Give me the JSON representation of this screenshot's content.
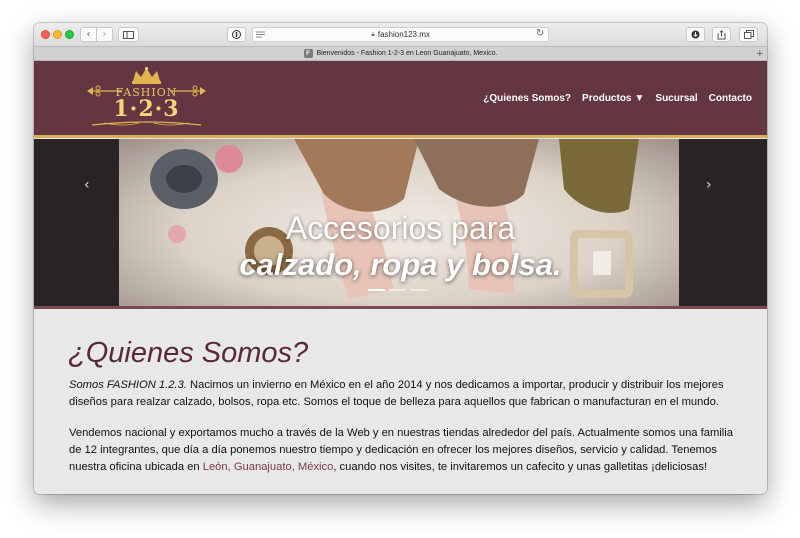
{
  "browser": {
    "url": "fashion123.mx",
    "tab_title": "Bienvenidos - Fashion 1-2-3 en Leon Guanajuato, Mexico.",
    "favicon_letter": "F",
    "icons": {
      "back": "chevron-left-icon",
      "forward": "chevron-right-icon",
      "sidebar": "sidebar-icon",
      "shield": "shield-icon",
      "reader": "reader-icon",
      "lock": "lock-icon",
      "reload": "reload-icon",
      "download": "download-icon",
      "share": "share-icon",
      "tabs": "tabs-icon",
      "new_tab": "plus-icon"
    }
  },
  "site": {
    "logo_line1": "FASHION",
    "logo_line2": "1·2·3",
    "nav": [
      {
        "label": "¿Quienes Somos?"
      },
      {
        "label": "Productos"
      },
      {
        "label": "Sucursal"
      },
      {
        "label": "Contacto"
      }
    ],
    "colors": {
      "header": "#633641",
      "gold": "#d8ae57"
    }
  },
  "hero": {
    "title_line1": "Accesorios para",
    "title_line2": "calzado, ropa y bolsa.",
    "slides": 3,
    "active_slide": 1
  },
  "about": {
    "heading": "¿Quienes Somos?",
    "p1_em": "Somos FASHION 1.2.3.",
    "p1_rest": " Nacimos un invierno en México en el año 2014 y nos dedicamos a importar, producir y distribuir los mejores diseños para realzar calzado, bolsos, ropa etc. Somos el toque de belleza para aquellos que fabrican o manufacturan en el mundo.",
    "p2_start": "Vendemos nacional y exportamos mucho a través de la Web y en nuestras tiendas alrededor del país. Actualmente somos una familia de 12 integrantes, que día a día ponemos nuestro tiempo y dedicación en ofrecer los mejores diseños, servicio y calidad. Tenemos nuestra oficina ubicada en ",
    "p2_link": "León, Guanajuato, México",
    "p2_end": ", cuando nos visites, te invitaremos un cafecito y unas galletitas ¡deliciosas!"
  }
}
